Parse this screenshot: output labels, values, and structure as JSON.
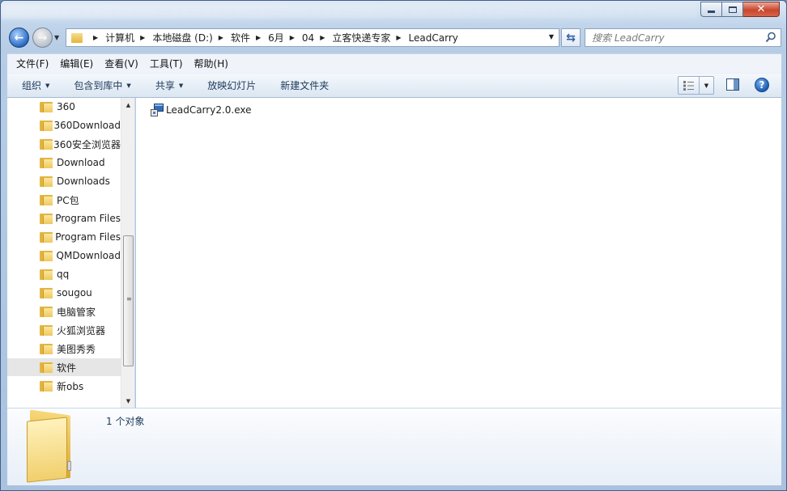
{
  "window": {
    "controls": {
      "minimize_icon": "minimize-icon",
      "maximize_icon": "maximize-icon",
      "close_icon": "close-icon"
    }
  },
  "address_bar": {
    "breadcrumbs": [
      "计算机",
      "本地磁盘 (D:)",
      "软件",
      "6月",
      "04",
      "立客快递专家",
      "LeadCarry"
    ],
    "search_placeholder": "搜索 LeadCarry"
  },
  "menubar": {
    "items": [
      "文件(F)",
      "编辑(E)",
      "查看(V)",
      "工具(T)",
      "帮助(H)"
    ]
  },
  "toolbar": {
    "organize": "组织",
    "include_in_library": "包含到库中",
    "share": "共享",
    "slideshow": "放映幻灯片",
    "new_folder": "新建文件夹"
  },
  "nav_pane": {
    "items": [
      "360",
      "360Download",
      "360安全浏览器",
      "Download",
      "Downloads",
      "PC包",
      "Program Files",
      "Program Files",
      "QMDownload",
      "qq",
      "sougou",
      "电脑管家",
      "火狐浏览器",
      "美图秀秀",
      "软件",
      "新obs"
    ],
    "selected": "软件"
  },
  "files": [
    {
      "name": "LeadCarry2.0.exe",
      "icon": "exe-icon"
    }
  ],
  "details_pane": {
    "count_text": "1 个对象"
  },
  "colors": {
    "accent": "#1e395b",
    "selection": "#e6e6e6",
    "close_button": "#c9452e"
  }
}
